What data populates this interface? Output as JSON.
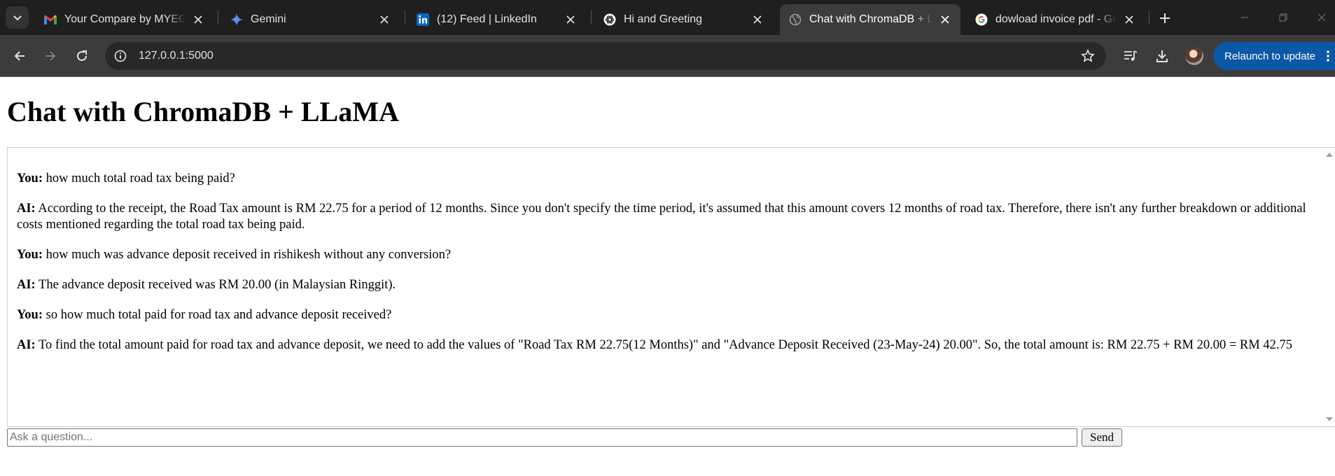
{
  "browser": {
    "tabs": [
      {
        "title": "Your Compare by MYEG E-",
        "icon": "gmail-icon"
      },
      {
        "title": "Gemini",
        "icon": "gemini-icon"
      },
      {
        "title": "(12) Feed | LinkedIn",
        "icon": "linkedin-icon"
      },
      {
        "title": "Hi and Greeting",
        "icon": "openai-icon"
      },
      {
        "title": "Chat with ChromaDB + LLaMA",
        "icon": "globe-icon",
        "active": true
      },
      {
        "title": "dowload invoice pdf - Goo",
        "icon": "google-icon"
      }
    ],
    "url": "127.0.0.1:5000",
    "relaunch_label": "Relaunch to update",
    "accent_color": "#0b57a8"
  },
  "page": {
    "title": "Chat with ChromaDB + LLaMA",
    "messages": [
      {
        "speaker": "You:",
        "text": " how much total road tax being paid?"
      },
      {
        "speaker": "AI:",
        "text": " According to the receipt, the Road Tax amount is RM 22.75 for a period of 12 months. Since you don't specify the time period, it's assumed that this amount covers 12 months of road tax. Therefore, there isn't any further breakdown or additional costs mentioned regarding the total road tax being paid."
      },
      {
        "speaker": "You:",
        "text": " how much was advance deposit received in rishikesh without any conversion?"
      },
      {
        "speaker": "AI:",
        "text": " The advance deposit received was RM 20.00 (in Malaysian Ringgit)."
      },
      {
        "speaker": "You:",
        "text": " so how much total paid for road tax and advance deposit received?"
      },
      {
        "speaker": "AI:",
        "text": " To find the total amount paid for road tax and advance deposit, we need to add the values of \"Road Tax RM 22.75(12 Months)\" and \"Advance Deposit Received (23-May-24) 20.00\". So, the total amount is: RM 22.75 + RM 20.00 = RM 42.75"
      }
    ],
    "input_placeholder": "Ask a question...",
    "input_value": "",
    "send_label": "Send"
  }
}
